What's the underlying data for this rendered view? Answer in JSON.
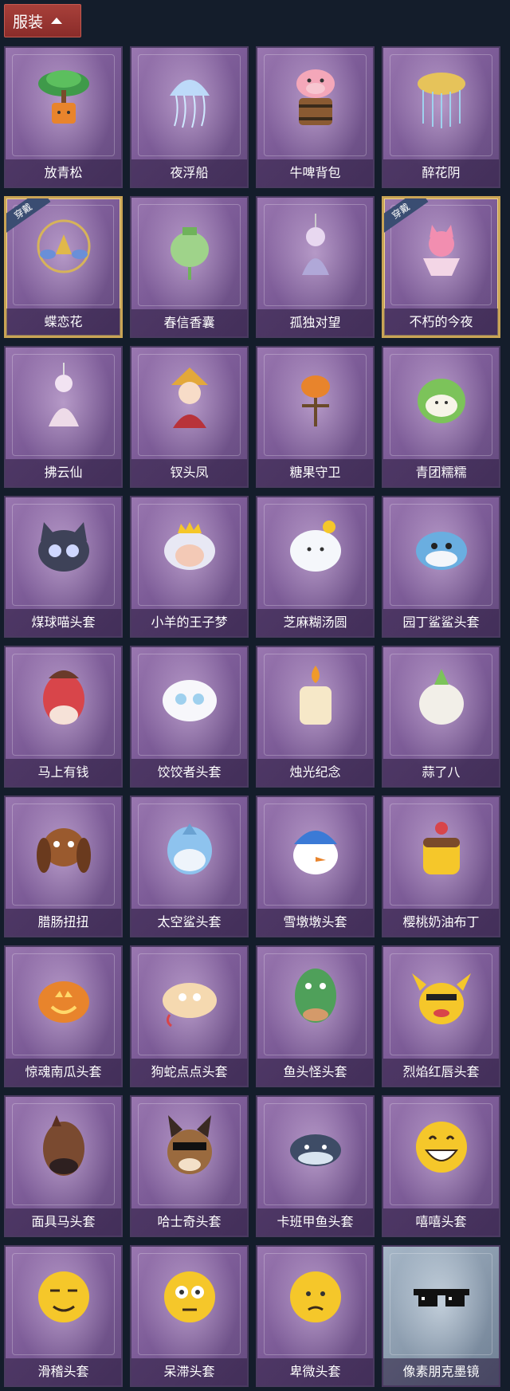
{
  "header": {
    "tab_label": "服装"
  },
  "items": [
    {
      "name": "放青松",
      "icon": "pine-bonsai-icon"
    },
    {
      "name": "夜浮船",
      "icon": "jellyfish-icon"
    },
    {
      "name": "牛啤背包",
      "icon": "cow-mug-icon"
    },
    {
      "name": "醉花阴",
      "icon": "flower-chandelier-icon"
    },
    {
      "name": "蝶恋花",
      "icon": "butterfly-bell-icon",
      "badge": "穿戴"
    },
    {
      "name": "春信香囊",
      "icon": "sachet-icon"
    },
    {
      "name": "孤独对望",
      "icon": "figure-pendant-icon"
    },
    {
      "name": "不朽的今夜",
      "icon": "fox-cup-icon",
      "badge": "穿戴"
    },
    {
      "name": "拂云仙",
      "icon": "fairy-pendant-icon"
    },
    {
      "name": "钗头凤",
      "icon": "phoenix-doll-icon"
    },
    {
      "name": "糖果守卫",
      "icon": "pumpkin-scarecrow-icon"
    },
    {
      "name": "青团糯糯",
      "icon": "green-mochi-icon"
    },
    {
      "name": "煤球喵头套",
      "icon": "black-cat-head-icon"
    },
    {
      "name": "小羊的王子梦",
      "icon": "sheep-crown-icon"
    },
    {
      "name": "芝麻糊汤圆",
      "icon": "rice-ball-icon"
    },
    {
      "name": "园丁鲨鲨头套",
      "icon": "shark-bee-icon"
    },
    {
      "name": "马上有钱",
      "icon": "red-horse-head-icon"
    },
    {
      "name": "饺饺者头套",
      "icon": "dumpling-cloud-icon"
    },
    {
      "name": "烛光纪念",
      "icon": "candle-head-icon"
    },
    {
      "name": "蒜了八",
      "icon": "garlic-head-icon"
    },
    {
      "name": "腊肠扭扭",
      "icon": "dachshund-head-icon"
    },
    {
      "name": "太空鲨头套",
      "icon": "space-shark-icon"
    },
    {
      "name": "雪墩墩头套",
      "icon": "snowman-head-icon"
    },
    {
      "name": "樱桃奶油布丁",
      "icon": "pudding-head-icon"
    },
    {
      "name": "惊魂南瓜头套",
      "icon": "jack-o-lantern-icon"
    },
    {
      "name": "狗蛇点点头套",
      "icon": "snake-head-icon"
    },
    {
      "name": "鱼头怪头套",
      "icon": "fish-monster-head-icon"
    },
    {
      "name": "烈焰红唇头套",
      "icon": "pikachu-lips-head-icon"
    },
    {
      "name": "面具马头套",
      "icon": "horse-mask-icon"
    },
    {
      "name": "哈士奇头套",
      "icon": "husky-sunglasses-icon"
    },
    {
      "name": "卡班甲鱼头套",
      "icon": "fish-head-icon"
    },
    {
      "name": "嘻嘻头套",
      "icon": "grin-emoji-icon"
    },
    {
      "name": "滑稽头套",
      "icon": "funny-emoji-icon"
    },
    {
      "name": "呆滞头套",
      "icon": "dazed-emoji-icon"
    },
    {
      "name": "卑微头套",
      "icon": "humble-emoji-icon"
    },
    {
      "name": "像素朋克墨镜",
      "icon": "pixel-sunglasses-icon",
      "gray": true
    }
  ],
  "colors": {
    "background": "#141d2b",
    "header_tab": "#9a3632",
    "worn_border": "#c9a455",
    "badge": "#3a4d72"
  }
}
